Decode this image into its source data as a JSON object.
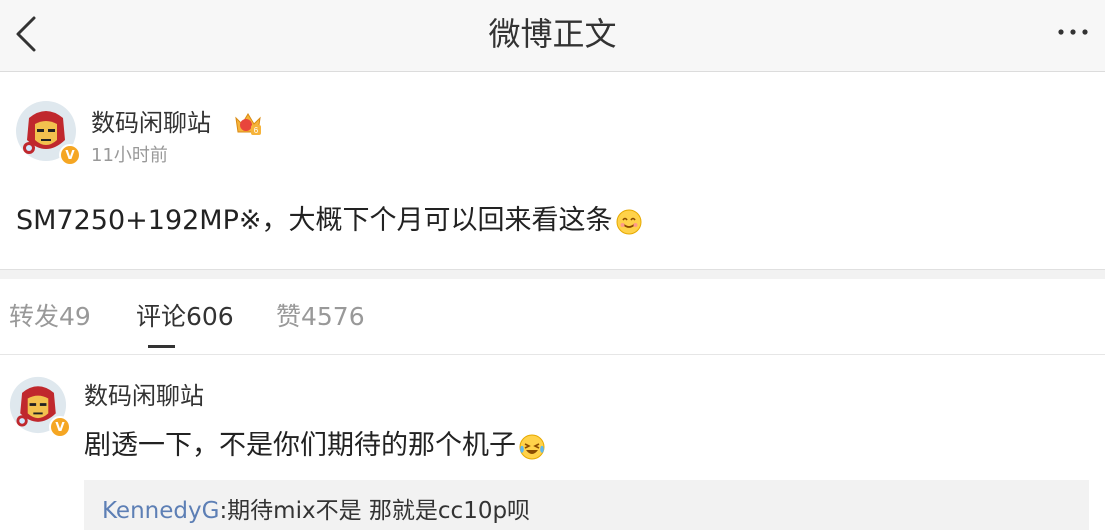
{
  "header": {
    "title": "微博正文",
    "back_icon": "back-chevron-icon",
    "more_icon": "more-dots-icon"
  },
  "post": {
    "author": "数码闲聊站",
    "time": "11小时前",
    "content": "SM7250+192MP※，大概下个月可以回来看这条",
    "verified_badge": "V",
    "emoji": "smile-emoji-icon"
  },
  "tabs": [
    {
      "label": "转发49",
      "active": false
    },
    {
      "label": "评论606",
      "active": true
    },
    {
      "label": "赞4576",
      "active": false
    }
  ],
  "comment": {
    "author": "数码闲聊站",
    "text": "剧透一下，不是你们期待的那个机子",
    "verified_badge": "V",
    "reply": {
      "name": "KennedyG",
      "text": ":期待mix不是 那就是cc10p呗"
    }
  },
  "colors": {
    "nav_bg": "#f7f7f7",
    "badge": "#f5a623",
    "link": "#5d7fb5",
    "muted": "#999999"
  }
}
